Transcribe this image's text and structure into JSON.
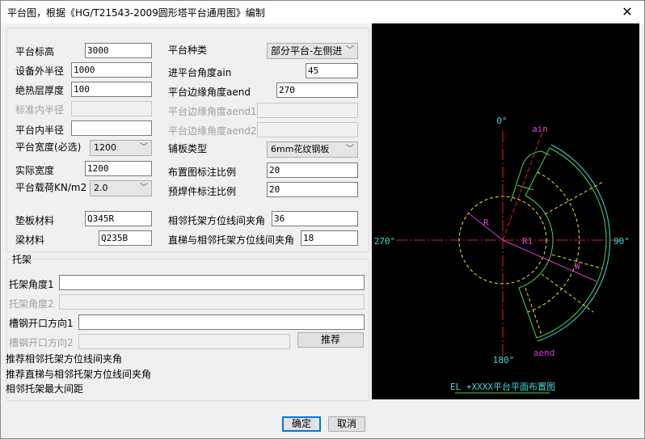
{
  "window": {
    "title": "平台图，根据《HG/T21543-2009圆形塔平台通用图》编制",
    "close": "✕"
  },
  "left": {
    "elevation": {
      "label": "平台标高",
      "value": "3000"
    },
    "outer_radius": {
      "label": "设备外半径",
      "value": "1000"
    },
    "insulation": {
      "label": "绝热层厚度",
      "value": "100"
    },
    "std_inner_radius": {
      "label": "标准内半径",
      "value": ""
    },
    "inner_radius": {
      "label": "平台内半径",
      "value": ""
    },
    "width": {
      "label": "平台宽度(必选)",
      "value": "1200"
    },
    "actual_width": {
      "label": "实际宽度",
      "value": "1200"
    },
    "load": {
      "label": "平台载荷KN/m2",
      "value": "2.0"
    },
    "pad_material": {
      "label": "垫板材料",
      "value": "Q345R"
    },
    "beam_material": {
      "label": "梁材料",
      "value": "Q235B"
    }
  },
  "right": {
    "type": {
      "label": "平台种类",
      "value": "部分平台-左侧进"
    },
    "ain": {
      "label": "进平台角度ain",
      "value": "45"
    },
    "aend": {
      "label": "平台边缘角度aend",
      "value": "270"
    },
    "aend1": {
      "label": "平台边缘角度aend1",
      "value": ""
    },
    "aend2": {
      "label": "平台边缘角度aend2",
      "value": ""
    },
    "plate": {
      "label": "铺板类型",
      "value": "6mm花纹钢板"
    },
    "layout_scale": {
      "label": "布置图标注比例",
      "value": "20"
    },
    "weld_scale": {
      "label": "预焊件标注比例",
      "value": "20"
    },
    "bracket_angle": {
      "label": "相邻托架方位线间夹角",
      "value": "36"
    },
    "ladder_angle": {
      "label": "直梯与相邻托架方位线间夹角",
      "value": "18"
    }
  },
  "bracket": {
    "group": "托架",
    "angle1": {
      "label": "托架角度1",
      "value": ""
    },
    "angle2": {
      "label": "托架角度2",
      "value": ""
    },
    "channel1": {
      "label": "槽钢开口方向1",
      "value": ""
    },
    "channel2": {
      "label": "槽钢开口方向2",
      "value": ""
    },
    "recommend": "推荐",
    "info": [
      "推荐相邻托架方位线间夹角",
      "推荐直梯与相邻托架方位线间夹角",
      "相邻托架最大间距"
    ]
  },
  "drawing": {
    "n": "0°",
    "e": "90°",
    "s": "180°",
    "w": "270°",
    "ain": "ain",
    "aend": "aend",
    "r": "R",
    "r1": "R1",
    "w_label": "W",
    "caption": "EL  +XXXX平台平面布置图"
  },
  "buttons": {
    "ok": "确定",
    "cancel": "取消"
  }
}
